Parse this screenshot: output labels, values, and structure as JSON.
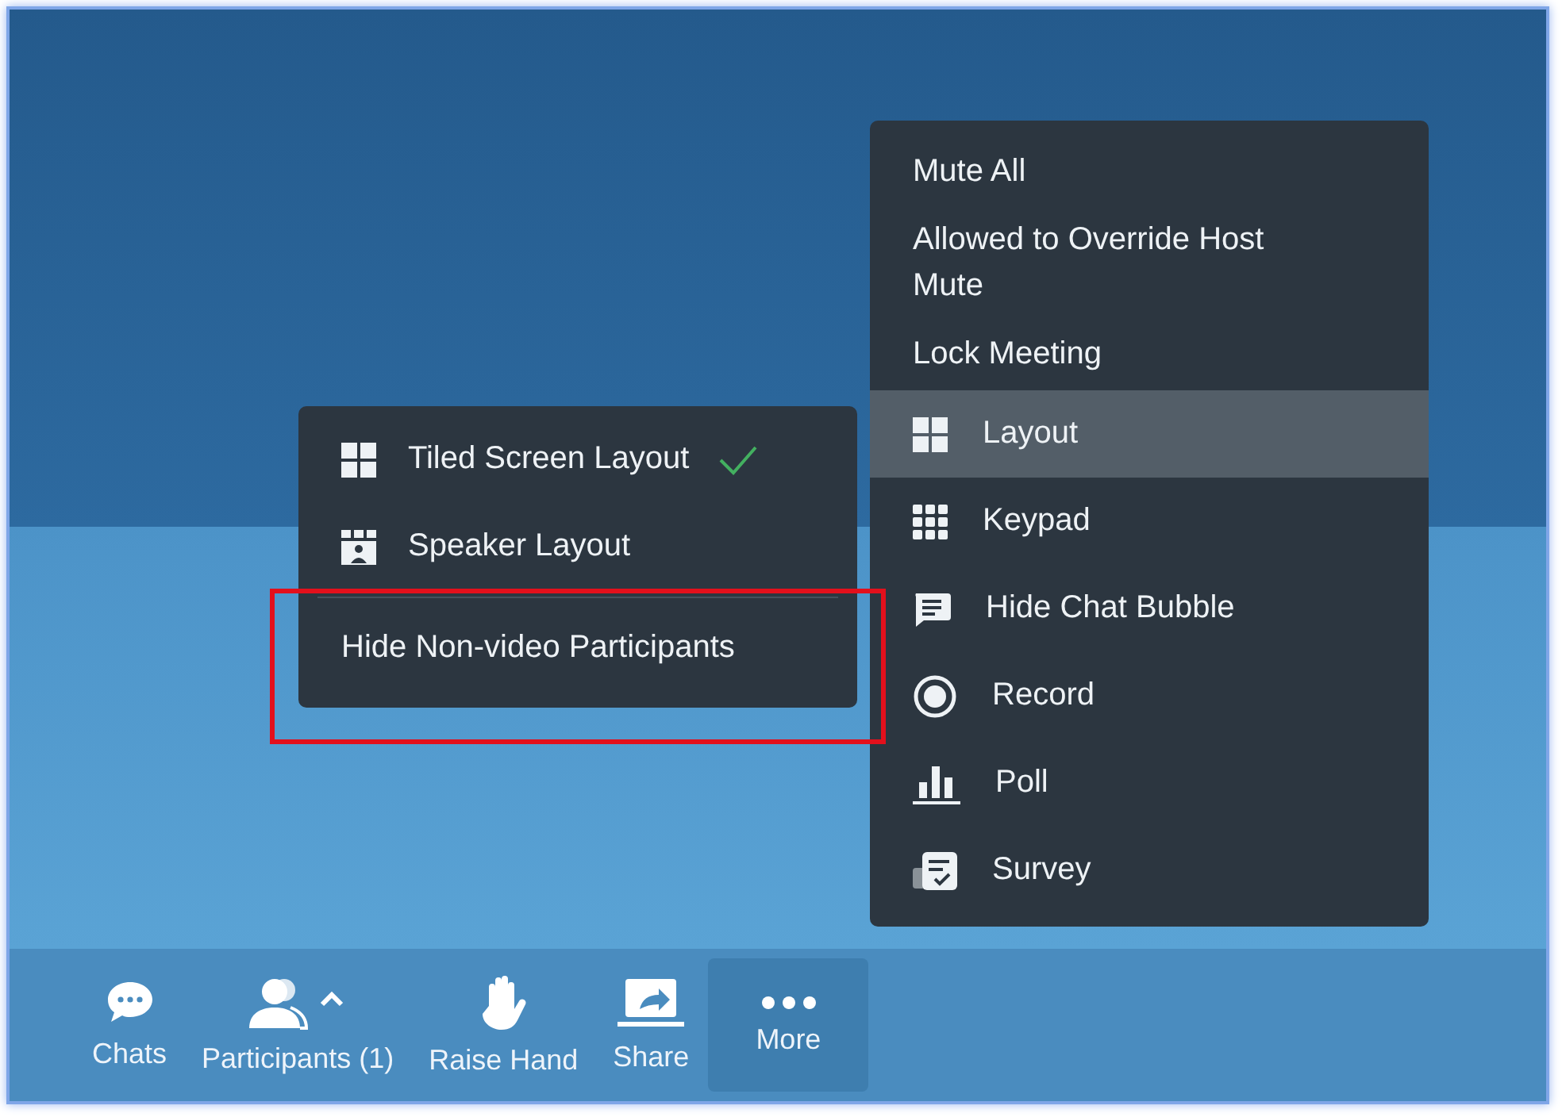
{
  "more_menu": {
    "items": [
      {
        "label": "Mute All",
        "kind": "text",
        "selected": false
      },
      {
        "label": "Allowed to Override Host Mute",
        "kind": "text",
        "selected": false
      },
      {
        "label": "Lock Meeting",
        "kind": "text",
        "selected": false
      },
      {
        "label": "Layout",
        "kind": "grid",
        "selected": true
      },
      {
        "label": "Keypad",
        "kind": "keypad",
        "selected": false
      },
      {
        "label": "Hide Chat Bubble",
        "kind": "chat",
        "selected": false
      },
      {
        "label": "Record",
        "kind": "record",
        "selected": false
      },
      {
        "label": "Poll",
        "kind": "poll",
        "selected": false
      },
      {
        "label": "Survey",
        "kind": "survey",
        "selected": false
      }
    ]
  },
  "layout_submenu": {
    "items": [
      {
        "label": "Tiled Screen Layout",
        "kind": "tiled",
        "checked": true
      },
      {
        "label": "Speaker Layout",
        "kind": "speaker",
        "checked": false
      },
      {
        "label": "Hide Non-video Participants",
        "kind": "text",
        "checked": false
      }
    ]
  },
  "toolbar": {
    "buttons": [
      {
        "label": "Chats",
        "kind": "chats",
        "selected": false
      },
      {
        "label": "Participants (1)",
        "kind": "participants",
        "selected": false
      },
      {
        "label": "Raise Hand",
        "kind": "hand",
        "selected": false
      },
      {
        "label": "Share",
        "kind": "share",
        "selected": false
      },
      {
        "label": "More",
        "kind": "more",
        "selected": true
      }
    ]
  }
}
